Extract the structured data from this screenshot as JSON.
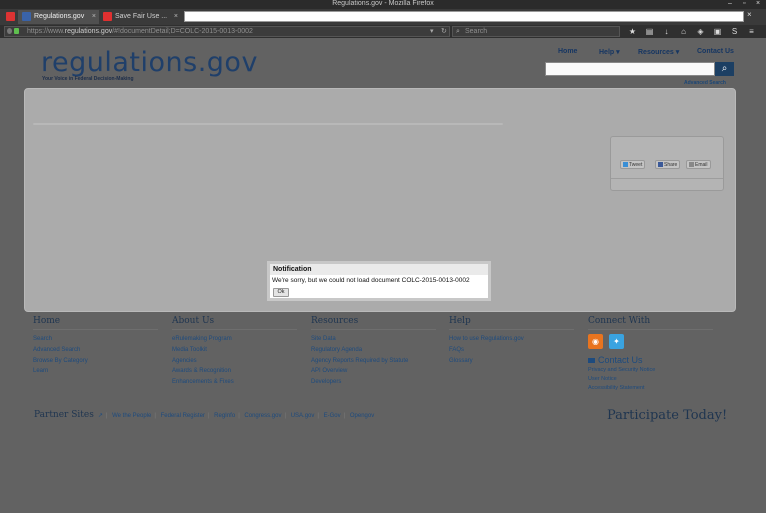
{
  "window": {
    "title": "Regulations.gov - Mozilla Firefox",
    "minimize": "–",
    "close": "×"
  },
  "tabs": [
    {
      "label": "Regulations.gov",
      "active": true,
      "favicon_color": "#3a63a8"
    },
    {
      "label": "Save Fair Use ...",
      "active": false,
      "favicon_color": "#e03030"
    }
  ],
  "navbar": {
    "url_scheme": "https://www.",
    "url_host": "regulations.gov",
    "url_path": "/#!documentDetail;D=COLC-2015-0013-0002",
    "search_placeholder": "Search",
    "icons": [
      "star-icon",
      "clipboard-icon",
      "download-icon",
      "home-icon",
      "shield-icon",
      "pocket-icon",
      "extension-icon",
      "menu-icon"
    ]
  },
  "site": {
    "logo_text": "regulations",
    "logo_suffix": ".gov",
    "tagline": "Your Voice in Federal Decision-Making",
    "nav": {
      "home": "Home",
      "help": "Help ▾",
      "resources": "Resources ▾",
      "contact": "Contact Us"
    },
    "advanced_search": "Advanced Search"
  },
  "share": {
    "tweet": "Tweet",
    "share": "Share",
    "email": "Email"
  },
  "notification": {
    "title": "Notification",
    "message": "We're sorry, but we could not load document COLC-2015-0013-0002",
    "ok": "Ok"
  },
  "footer": {
    "home": {
      "title": "Home",
      "links": [
        "Search",
        "Advanced Search",
        "Browse By Category",
        "Learn"
      ]
    },
    "about": {
      "title": "About Us",
      "links": [
        "eRulemaking Program",
        "Media Toolkit",
        "Agencies",
        "Awards & Recognition",
        "Enhancements & Fixes"
      ]
    },
    "resources": {
      "title": "Resources",
      "links": [
        "Site Data",
        "Regulatory Agenda",
        "Agency Reports Required by Statute",
        "API Overview",
        "Developers"
      ]
    },
    "help": {
      "title": "Help",
      "links": [
        "How to use Regulations.gov",
        "FAQs",
        "Glossary"
      ]
    },
    "connect": {
      "title": "Connect With",
      "contact_title": "Contact Us",
      "links": [
        "Privacy and Security Notice",
        "User Notice",
        "Accessibility Statement"
      ]
    },
    "partner_title": "Partner Sites",
    "partners": [
      "We the People",
      "Federal Register",
      "RegInfo",
      "Congress.gov",
      "USA.gov",
      "E-Gov",
      "Opengov"
    ],
    "participate": "Participate Today!"
  }
}
